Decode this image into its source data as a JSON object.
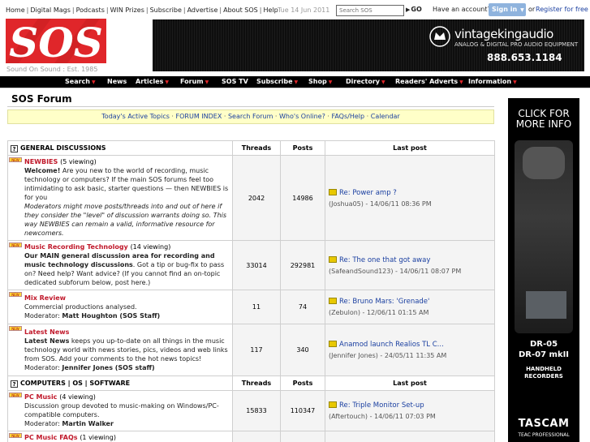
{
  "top_links": [
    "Home",
    "Digital Mags",
    "Podcasts",
    "WIN Prizes",
    "Subscribe",
    "Advertise",
    "About SOS",
    "Help"
  ],
  "date": "Tue 14 Jun 2011",
  "search": {
    "placeholder": "Search SOS",
    "go_label": "GO"
  },
  "account": {
    "prompt": "Have an account?",
    "signin_label": "Sign in",
    "or": "or",
    "register_label": "Register for free"
  },
  "logo": {
    "text": "SOS",
    "tagline": "Sound On Sound : Est. 1985",
    "color": "#e0262a"
  },
  "banner": {
    "brand": "vintagekingaudio",
    "sub": "ANALOG & DIGITAL PRO AUDIO EQUIPMENT",
    "phone": "888.653.1184"
  },
  "nav": [
    {
      "label": "Search",
      "caret": true
    },
    {
      "label": "News",
      "caret": false
    },
    {
      "label": "Articles",
      "caret": true
    },
    {
      "label": "Forum",
      "caret": true
    },
    {
      "label": "SOS TV",
      "caret": false
    },
    {
      "label": "Subscribe",
      "caret": true
    },
    {
      "label": "Shop",
      "caret": true
    },
    {
      "label": "Directory",
      "caret": true
    },
    {
      "label": "Readers' Adverts",
      "caret": true
    },
    {
      "label": "Information",
      "caret": true
    }
  ],
  "forum": {
    "title": "SOS Forum",
    "quicklinks": [
      "Today's Active Topics",
      "FORUM INDEX",
      "Search Forum",
      "Who's Online?",
      "FAQs/Help",
      "Calendar"
    ],
    "columns": {
      "threads": "Threads",
      "posts": "Posts",
      "last_post": "Last post"
    },
    "categories": [
      {
        "name": "GENERAL DISCUSSIONS",
        "forums": [
          {
            "name": "NEWBIES",
            "viewing": "(5 viewing)",
            "desc_bold": "Welcome!",
            "desc": " Are you new to the world of recording, music technology or computers? If the main SOS forums feel too intimidating to ask basic, starter questions — then NEWBIES is for you",
            "desc_italic": "Moderators might move posts/threads into and out of here if they consider the \"level\" of discussion warrants doing so. This way NEWBIES can remain a valid, informative resource for newcomers.",
            "threads": "2042",
            "posts": "14986",
            "last_title": "Re: Power amp ?",
            "last_meta": "(Joshua05) - 14/06/11 08:36 PM"
          },
          {
            "name": "Music Recording Technology",
            "viewing": "(14 viewing)",
            "desc_bold": "Our MAIN general discussion area for recording and music technology discussions",
            "desc": ". Got a tip or bug-fix to pass on? Need help? Want advice? (If you cannot find an on-topic dedicated subforum below, post here.)",
            "desc_italic": "",
            "threads": "33014",
            "posts": "292981",
            "last_title": "Re: The one that got away",
            "last_meta": "(SafeandSound123) - 14/06/11 08:07 PM"
          },
          {
            "name": "Mix Review",
            "viewing": "",
            "desc_bold": "",
            "desc": "Commercial productions analysed.",
            "moderator_label": "Moderator:",
            "moderator": "Matt Houghton (SOS Staff)",
            "desc_italic": "",
            "threads": "11",
            "posts": "74",
            "last_title": "Re: Bruno Mars: 'Grenade'",
            "last_meta": "(Zebulon) - 12/06/11 01:15 AM"
          },
          {
            "name": "Latest News",
            "viewing": "",
            "desc_bold": "Latest News",
            "desc": " keeps you up-to-date on all things in the music technology world with news stories, pics, videos and web links from SOS. Add your comments to the hot news topics!",
            "moderator_label": "Moderator:",
            "moderator": "Jennifer Jones (SOS staff)",
            "desc_italic": "",
            "threads": "117",
            "posts": "340",
            "last_title": "Anamod launch Realios TL C...",
            "last_meta": "(Jennifer Jones) - 24/05/11 11:35 AM"
          }
        ]
      },
      {
        "name": "COMPUTERS | OS | SOFTWARE",
        "forums": [
          {
            "name": "PC Music",
            "viewing": "(4 viewing)",
            "desc_bold": "",
            "desc": "Discussion group devoted to music-making on Windows/PC-compatible computers.",
            "moderator_label": "Moderator:",
            "moderator": "Martin Walker",
            "desc_italic": "",
            "threads": "15833",
            "posts": "110347",
            "last_title": "Re: Triple Monitor Set-up",
            "last_meta": "(Aftertouch) - 14/06/11 07:03 PM"
          },
          {
            "name": "PC Music FAQs",
            "viewing": "(1 viewing)",
            "desc_bold": "",
            "desc": "",
            "desc_italic": "",
            "threads": "",
            "posts": "",
            "last_title": "",
            "last_meta": ""
          }
        ]
      }
    ]
  },
  "side_ad": {
    "headline": "CLICK FOR MORE INFO",
    "model1": "DR-05",
    "model2": "DR-07 mkII",
    "line1": "HANDHELD",
    "line2": "RECORDERS",
    "brand": "TASCAM",
    "brand_sub": "TEAC PROFESSIONAL"
  }
}
